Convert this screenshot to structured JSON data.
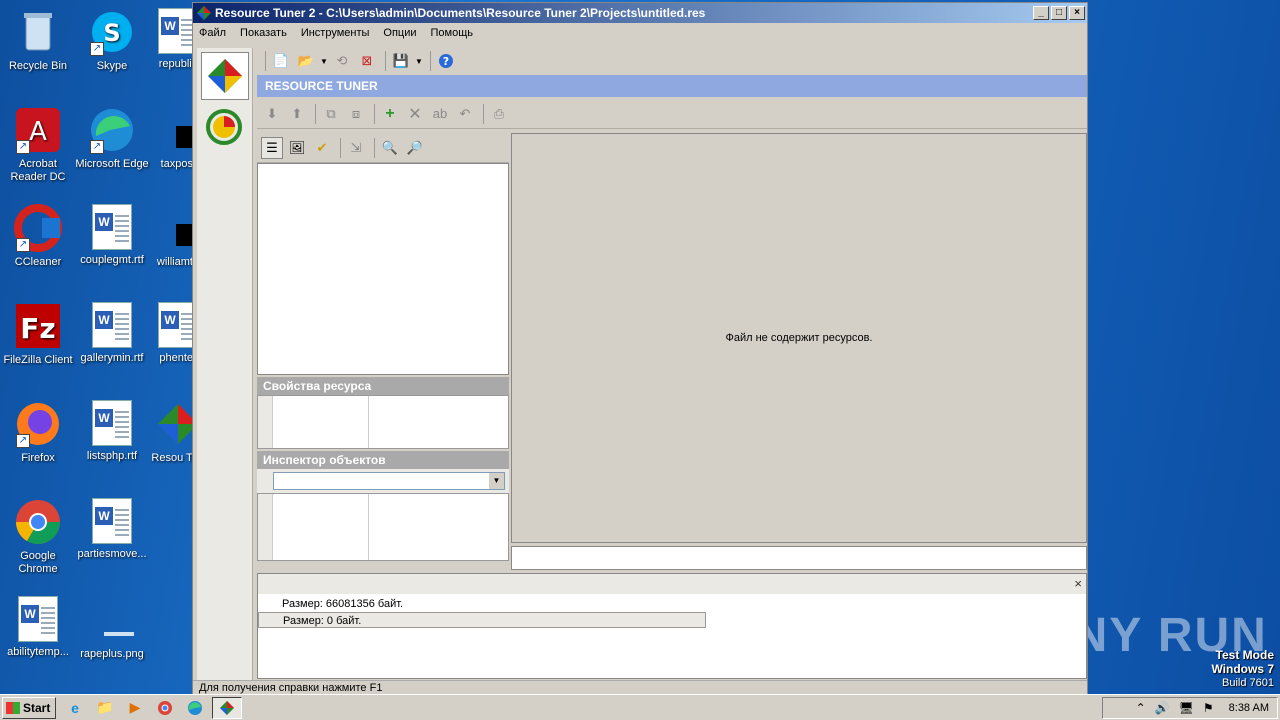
{
  "desktop": {
    "icons": [
      {
        "label": "Recycle Bin",
        "icon": "recycle-bin-icon"
      },
      {
        "label": "Skype",
        "icon": "skype-icon"
      },
      {
        "label": "republic",
        "icon": "word-doc-icon"
      },
      {
        "label": "Acrobat Reader DC",
        "icon": "acrobat-icon"
      },
      {
        "label": "Microsoft Edge",
        "icon": "edge-icon"
      },
      {
        "label": "taxposi",
        "icon": "black-file-icon"
      },
      {
        "label": "CCleaner",
        "icon": "ccleaner-icon"
      },
      {
        "label": "couplegmt.rtf",
        "icon": "word-doc-icon"
      },
      {
        "label": "williamth",
        "icon": "black-file-icon"
      },
      {
        "label": "FileZilla Client",
        "icon": "filezilla-icon"
      },
      {
        "label": "gallerymin.rtf",
        "icon": "word-doc-icon"
      },
      {
        "label": "phenter",
        "icon": "word-doc-icon"
      },
      {
        "label": "Firefox",
        "icon": "firefox-icon"
      },
      {
        "label": "listsphp.rtf",
        "icon": "word-doc-icon"
      },
      {
        "label": "Resou Tun",
        "icon": "resource-tuner-icon"
      },
      {
        "label": "Google Chrome",
        "icon": "chrome-icon"
      },
      {
        "label": "partiesmove...",
        "icon": "word-doc-icon"
      },
      {
        "label": "abilitytemp...",
        "icon": "word-doc-icon"
      },
      {
        "label": "rapeplus.png",
        "icon": "image-file-icon"
      }
    ],
    "watermark": "ANY RUN",
    "test_mode": {
      "line1": "Test Mode",
      "line2": "Windows 7",
      "line3": "Build 7601"
    }
  },
  "window": {
    "title": "Resource Tuner 2 - C:\\Users\\admin\\Documents\\Resource Tuner 2\\Projects\\untitled.res",
    "controls": {
      "minimize": "_",
      "maximize": "□",
      "close": "×"
    },
    "menu": [
      "Файл",
      "Показать",
      "Инструменты",
      "Опции",
      "Помощь"
    ],
    "banner": "RESOURCE TUNER",
    "properties_header": "Свойства ресурса",
    "inspector_header": "Инспектор объектов",
    "main_message": "Файл не содержит ресурсов.",
    "size_line1": "Размер: 66081356 байт.",
    "size_line2": "Размер: 0 байт.",
    "close_symbol": "×",
    "status": "Для получения справки нажмите F1"
  },
  "taskbar": {
    "start": "Start",
    "time": "8:38 AM"
  }
}
